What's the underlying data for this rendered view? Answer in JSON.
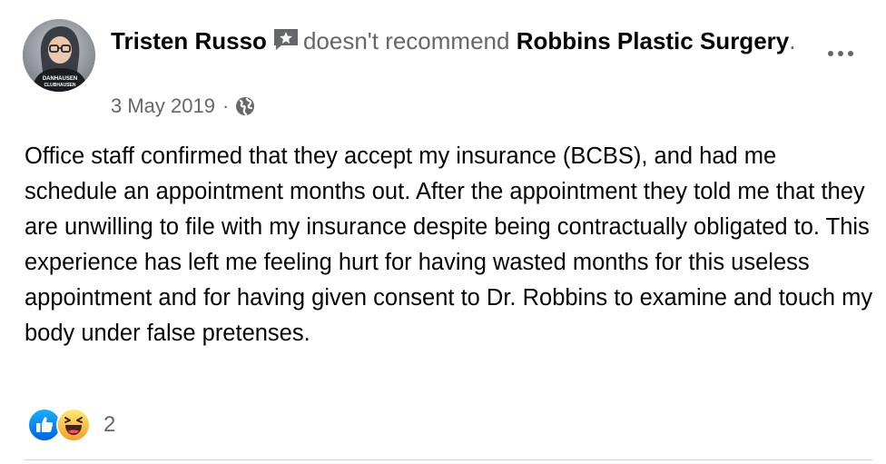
{
  "review": {
    "author": "Tristen Russo",
    "verb": "doesn't recommend",
    "page_name": "Robbins Plastic Surgery",
    "page_name_suffix": ".",
    "date": "3 May 2019",
    "separator": "·",
    "privacy_icon": "globe-icon",
    "badge_icon": "star-badge-icon",
    "more_icon": "more-options-icon",
    "text": "Office staff confirmed that they accept my insurance (BCBS), and had me schedule an appointment months out. After the appointment they told me that they are unwilling to file with my insurance despite being contractually obligated to. This experience has left me feeling hurt for having wasted months for this useless appointment and for having given consent to Dr. Robbins to examine and touch my body under false pretenses."
  },
  "avatar": {
    "shirt_text_line1": "DANHAUSEN",
    "shirt_text_line2": "CLUBHAUSEN"
  },
  "reactions": {
    "types": [
      "like-icon",
      "haha-icon"
    ],
    "count": "2"
  },
  "colors": {
    "primary_text": "#050505",
    "secondary_text": "#65676b",
    "like_blue": "#1877f2",
    "haha_yellow": "#f7b125",
    "divider": "#ced0d4"
  }
}
